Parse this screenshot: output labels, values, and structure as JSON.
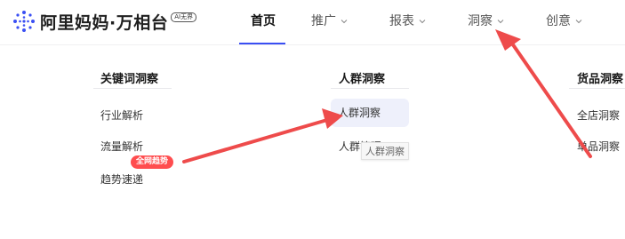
{
  "header": {
    "logo_text": "阿里妈妈·万相台",
    "logo_badge": "AI无界",
    "nav": [
      {
        "label": "首页",
        "active": true
      },
      {
        "label": "推广",
        "has_dropdown": true
      },
      {
        "label": "报表",
        "has_dropdown": true
      },
      {
        "label": "洞察",
        "has_dropdown": true
      },
      {
        "label": "创意",
        "has_dropdown": true
      }
    ]
  },
  "dropdown": {
    "columns": [
      {
        "title": "关键词洞察",
        "items": [
          "行业解析",
          "流量解析",
          "趋势速递"
        ]
      },
      {
        "title": "人群洞察",
        "items": [
          "人群洞察",
          "人群管理"
        ]
      },
      {
        "title": "货品洞察",
        "items": [
          "全店洞察",
          "单品洞察"
        ]
      }
    ],
    "badge": "全网趋势",
    "tooltip": "人群洞察"
  },
  "colors": {
    "accent": "#3a4ff3",
    "badge_red": "#ff4d4f",
    "arrow_red": "#ee4b4b",
    "hover_bg": "#eef0fb"
  }
}
